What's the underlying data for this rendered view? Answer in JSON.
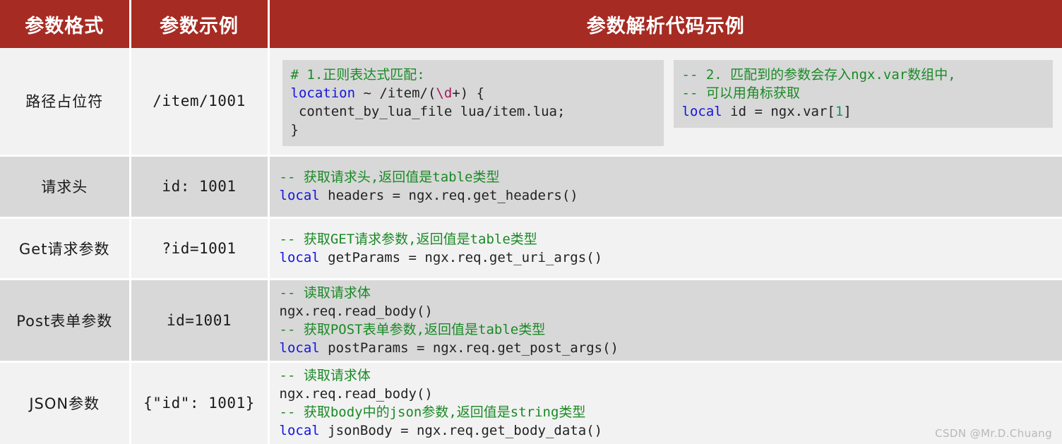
{
  "table": {
    "columns": [
      {
        "label": "参数格式",
        "key": "format"
      },
      {
        "label": "参数示例",
        "key": "example"
      },
      {
        "label": "参数解析代码示例",
        "key": "code"
      }
    ],
    "rows": [
      {
        "format": "路径占位符",
        "example": "/item/1001",
        "blocks": [
          {
            "lines": [
              [
                {
                  "t": "# 1.正则表达式匹配:",
                  "c": "comment"
                }
              ],
              [
                {
                  "t": "location",
                  "c": "kw"
                },
                {
                  "t": " ~ /item/(",
                  "c": "plain"
                },
                {
                  "t": "\\d",
                  "c": "regex"
                },
                {
                  "t": "+) {",
                  "c": "plain"
                }
              ],
              [
                {
                  "t": " content_by_lua_file lua/item.lua;",
                  "c": "plain"
                }
              ],
              [
                {
                  "t": "}",
                  "c": "plain"
                }
              ]
            ]
          },
          {
            "lines": [
              [
                {
                  "t": "-- 2. 匹配到的参数会存入ngx.var数组中,",
                  "c": "comment"
                }
              ],
              [
                {
                  "t": "-- 可以用角标获取",
                  "c": "comment"
                }
              ],
              [
                {
                  "t": "local",
                  "c": "kw"
                },
                {
                  "t": " id = ngx.var[",
                  "c": "plain"
                },
                {
                  "t": "1",
                  "c": "num"
                },
                {
                  "t": "]",
                  "c": "plain"
                }
              ]
            ]
          }
        ]
      },
      {
        "format": "请求头",
        "example": "id: 1001",
        "blocks": [
          {
            "plain": true,
            "lines": [
              [
                {
                  "t": "-- 获取请求头,返回值是table类型",
                  "c": "comment"
                }
              ],
              [
                {
                  "t": "local",
                  "c": "kw"
                },
                {
                  "t": " headers = ngx.req.get_headers()",
                  "c": "plain"
                }
              ]
            ]
          }
        ]
      },
      {
        "format": "Get请求参数",
        "example": "?id=1001",
        "blocks": [
          {
            "plain": true,
            "lines": [
              [
                {
                  "t": "-- 获取GET请求参数,返回值是table类型",
                  "c": "comment"
                }
              ],
              [
                {
                  "t": "local",
                  "c": "kw"
                },
                {
                  "t": " getParams = ngx.req.get_uri_args()",
                  "c": "plain"
                }
              ]
            ]
          }
        ]
      },
      {
        "format": "Post表单参数",
        "example": "id=1001",
        "blocks": [
          {
            "plain": true,
            "lines": [
              [
                {
                  "t": "-- 读取请求体",
                  "c": "comment"
                }
              ],
              [
                {
                  "t": "ngx.req.read_body()",
                  "c": "plain"
                }
              ],
              [
                {
                  "t": "-- 获取POST表单参数,返回值是table类型",
                  "c": "comment"
                }
              ],
              [
                {
                  "t": "local",
                  "c": "kw"
                },
                {
                  "t": " postParams = ngx.req.get_post_args()",
                  "c": "plain"
                }
              ]
            ]
          }
        ]
      },
      {
        "format": "JSON参数",
        "example": "{\"id\": 1001}",
        "blocks": [
          {
            "plain": true,
            "lines": [
              [
                {
                  "t": "-- 读取请求体",
                  "c": "comment"
                }
              ],
              [
                {
                  "t": "ngx.req.read_body()",
                  "c": "plain"
                }
              ],
              [
                {
                  "t": "-- 获取body中的json参数,返回值是string类型",
                  "c": "comment"
                }
              ],
              [
                {
                  "t": "local",
                  "c": "kw"
                },
                {
                  "t": " jsonBody = ngx.req.get_body_data()",
                  "c": "plain"
                }
              ]
            ]
          }
        ]
      }
    ]
  },
  "watermark": "CSDN @Mr.D.Chuang",
  "colors": {
    "header_bg": "#a62b23",
    "header_text": "#ffffff",
    "row_light": "#f2f2f2",
    "row_dark": "#d8d8d8",
    "code_block_bg": "#d8d8d8",
    "comment": "#1a8a26",
    "keyword": "#1414e0",
    "number": "#0a9b58",
    "regex": "#a8185c",
    "plain_text": "#222222",
    "grid_line": "#ffffff",
    "watermark": "#b8b8b8"
  }
}
